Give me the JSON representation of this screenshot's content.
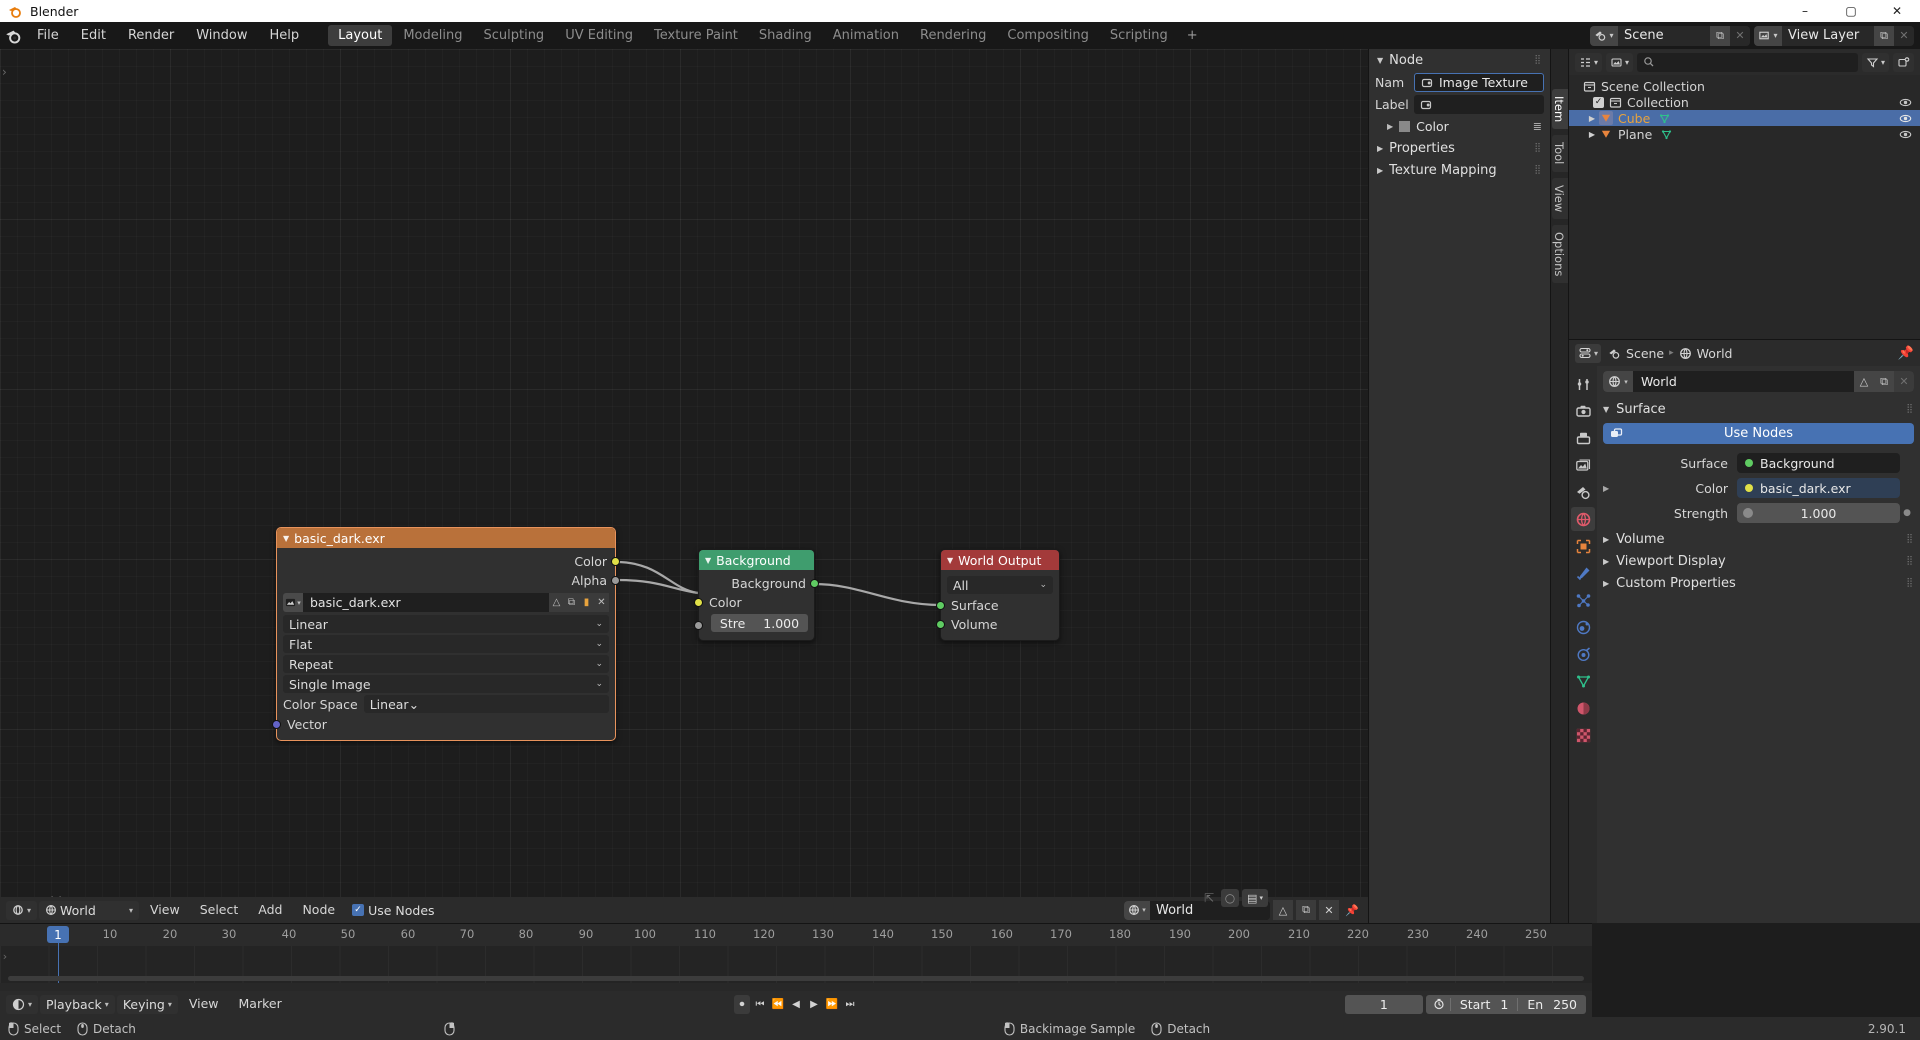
{
  "window": {
    "title": "Blender",
    "minimize": "–",
    "maximize": "▢",
    "close": "✕"
  },
  "topbar": {
    "menus": [
      "File",
      "Edit",
      "Render",
      "Window",
      "Help"
    ],
    "workspaces": [
      {
        "label": "Layout",
        "active": true
      },
      {
        "label": "Modeling",
        "active": false
      },
      {
        "label": "Sculpting",
        "active": false
      },
      {
        "label": "UV Editing",
        "active": false
      },
      {
        "label": "Texture Paint",
        "active": false
      },
      {
        "label": "Shading",
        "active": false
      },
      {
        "label": "Animation",
        "active": false
      },
      {
        "label": "Rendering",
        "active": false
      },
      {
        "label": "Compositing",
        "active": false
      },
      {
        "label": "Scripting",
        "active": false
      },
      {
        "label": "+",
        "active": false
      }
    ],
    "scene": {
      "name": "Scene",
      "copy": "⧉",
      "close": "✕"
    },
    "view_layer": {
      "name": "View Layer",
      "copy": "⧉",
      "close": "✕"
    }
  },
  "node_editor": {
    "canvas_label": "World",
    "header": {
      "editor_type": "shader-editor",
      "shader_type": "World",
      "menus": [
        "View",
        "Select",
        "Add",
        "Node"
      ],
      "use_nodes_label": "Use Nodes",
      "use_nodes_checked": true,
      "id_name": "World",
      "snap_label": "",
      "overlay_label": ""
    },
    "nodes": [
      {
        "name": "basic_dark.exr",
        "type": "image-texture",
        "header_color": "#b9713a",
        "selected": true,
        "outputs": [
          {
            "label": "Color",
            "color": "yellow"
          },
          {
            "label": "Alpha",
            "color": "grey"
          }
        ],
        "image_field": "basic_dark.exr",
        "dropdowns": [
          "Linear",
          "Flat",
          "Repeat",
          "Single Image"
        ],
        "color_space_label": "Color Space",
        "color_space_value": "Linear",
        "inputs": [
          {
            "label": "Vector",
            "color": "purple"
          }
        ]
      },
      {
        "name": "Background",
        "type": "background",
        "header_color": "#3f9d6e",
        "selected": false,
        "outputs": [
          {
            "label": "Background",
            "color": "green"
          }
        ],
        "inputs": [
          {
            "label": "Color",
            "color": "yellow"
          }
        ],
        "strength_label": "Stre",
        "strength_value": "1.000"
      },
      {
        "name": "World Output",
        "type": "world-output",
        "header_color": "#a33a3a",
        "selected": false,
        "target_value": "All",
        "inputs": [
          {
            "label": "Surface",
            "color": "green"
          },
          {
            "label": "Volume",
            "color": "green"
          }
        ]
      }
    ]
  },
  "sidebar": {
    "tabs": [
      {
        "label": "Item",
        "active": false
      },
      {
        "label": "Tool",
        "active": false
      },
      {
        "label": "View",
        "active": false
      },
      {
        "label": "Options",
        "active": false
      }
    ],
    "node_panel": {
      "title": "Node",
      "name_label": "Nam",
      "name_value": "Image Texture",
      "label_label": "Label",
      "label_value": "",
      "color_label": "Color"
    },
    "properties_panel": "Properties",
    "texture_mapping_panel": "Texture Mapping"
  },
  "outliner": {
    "display_mode": "view-layer",
    "filter_icon": "filter-icon",
    "new_collection_icon": "new-collection-icon",
    "search_placeholder": "",
    "rows": [
      {
        "label": "Scene Collection",
        "indent": 0,
        "icon": "collection-icon",
        "selected": false,
        "checkbox": false,
        "eye": false,
        "color": "#d4d4d4"
      },
      {
        "label": "Collection",
        "indent": 1,
        "icon": "collection-icon",
        "selected": false,
        "checkbox": true,
        "eye": true,
        "color": "#d4d4d4"
      },
      {
        "label": "Cube",
        "indent": 2,
        "icon": "object-icon",
        "selected": true,
        "checkbox": false,
        "eye": true,
        "color": "#e8a33d",
        "mesh": true
      },
      {
        "label": "Plane",
        "indent": 2,
        "icon": "object-icon",
        "selected": false,
        "checkbox": false,
        "eye": true,
        "color": "#d4d4d4",
        "mesh": true
      }
    ]
  },
  "properties": {
    "breadcrumb": [
      "Scene",
      "World"
    ],
    "pin_icon": "pin-icon",
    "id_name": "World",
    "tabs": [
      {
        "name": "tool",
        "active": false
      },
      {
        "name": "render",
        "active": false
      },
      {
        "name": "output",
        "active": false
      },
      {
        "name": "view-layer",
        "active": false
      },
      {
        "name": "scene",
        "active": false
      },
      {
        "name": "world",
        "active": true
      },
      {
        "name": "object",
        "active": false
      },
      {
        "name": "modifiers",
        "active": false
      },
      {
        "name": "particles",
        "active": false
      },
      {
        "name": "physics",
        "active": false
      },
      {
        "name": "constraints",
        "active": false
      },
      {
        "name": "object-data",
        "active": false
      },
      {
        "name": "material",
        "active": false
      },
      {
        "name": "texture",
        "active": false
      }
    ],
    "surface_panel": "Surface",
    "use_nodes_button": "Use Nodes",
    "rows": [
      {
        "label": "Surface",
        "value": "Background",
        "style": "enum",
        "dot": "#5fcb62",
        "arrow": false
      },
      {
        "label": "Color",
        "value": "basic_dark.exr",
        "style": "link",
        "dot": "#e0e048",
        "arrow": true
      },
      {
        "label": "Strength",
        "value": "1.000",
        "style": "slider",
        "dot": "#8a8a8a",
        "arrow": false
      }
    ],
    "collapsed_panels": [
      "Volume",
      "Viewport Display",
      "Custom Properties"
    ]
  },
  "timeline": {
    "ticks": [
      10,
      20,
      30,
      40,
      50,
      60,
      70,
      80,
      90,
      100,
      110,
      120,
      130,
      140,
      150,
      160,
      170,
      180,
      190,
      200,
      210,
      220,
      230,
      240,
      250
    ],
    "current_frame": "1",
    "menus": [
      {
        "label": "Playback",
        "dropdown": true
      },
      {
        "label": "Keying",
        "dropdown": true
      },
      {
        "label": "View",
        "dropdown": false
      },
      {
        "label": "Marker",
        "dropdown": false
      }
    ],
    "transport": [
      "⏺",
      "⏮",
      "⏪",
      "◀",
      "▶",
      "⏩",
      "⏭"
    ],
    "frame_value": "1",
    "start_label": "Start",
    "start_value": "1",
    "end_label": "En",
    "end_value": "250"
  },
  "statusbar": {
    "left": [
      {
        "mouse": "left",
        "label": "Select"
      },
      {
        "mouse": "middle",
        "label": "Detach"
      }
    ],
    "center": [
      {
        "mouse": "right",
        "label": ""
      }
    ],
    "right": [
      {
        "mouse": "left",
        "label": "Backimage Sample"
      },
      {
        "mouse": "middle",
        "label": "Detach"
      }
    ],
    "version": "2.90.1"
  }
}
